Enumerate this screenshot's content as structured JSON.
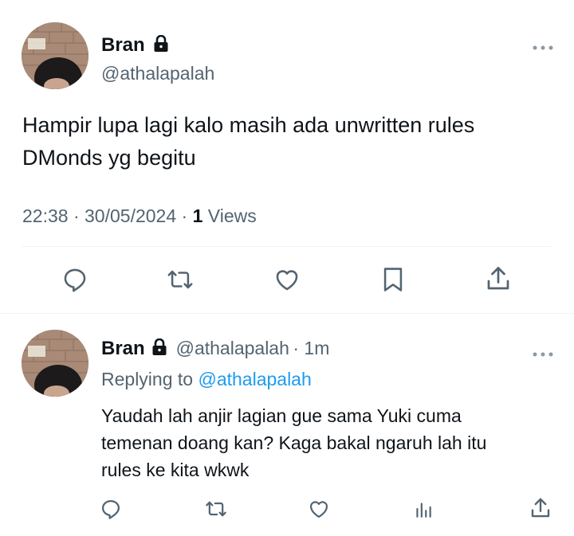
{
  "main_tweet": {
    "author_name": "Bran",
    "author_handle": "@athalapalah",
    "more_icon": "more-horizontal-icon",
    "text_line1": "Hampir lupa lagi kalo masih ada unwritten rules",
    "text_line2": "DMonds yg begitu",
    "time": "22:38",
    "date": "30/05/2024",
    "views_count": "1",
    "views_label": "Views",
    "actions": [
      "reply-icon",
      "retweet-icon",
      "like-icon",
      "bookmark-icon",
      "share-icon"
    ]
  },
  "reply": {
    "author_name": "Bran",
    "author_handle": "@athalapalah",
    "age": "1m",
    "replying_to_label": "Replying to",
    "replying_to_handle": "@athalapalah",
    "text_line1": "Yaudah lah anjir lagian gue sama Yuki cuma",
    "text_line2": "temenan doang kan? Kaga bakal ngaruh lah itu",
    "text_line3": "rules ke kita wkwk",
    "actions": [
      "reply-icon",
      "retweet-icon",
      "like-icon",
      "analytics-icon",
      "share-icon"
    ]
  },
  "colors": {
    "text": "#0f1419",
    "secondary": "#536471",
    "link": "#1d9bf0",
    "divider": "#eff3f4"
  }
}
